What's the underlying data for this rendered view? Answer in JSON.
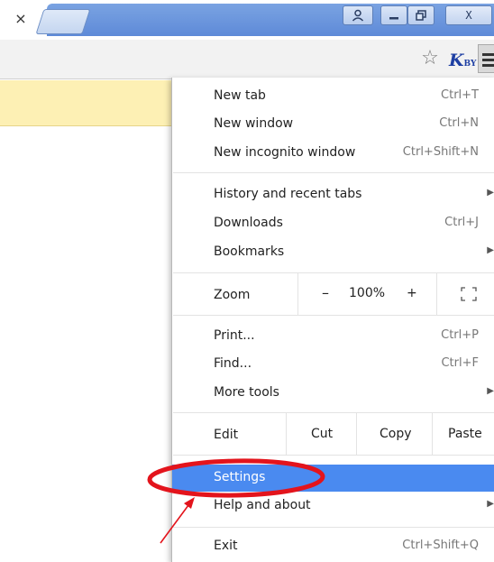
{
  "window": {
    "tab_close": "×",
    "user_button": "☃",
    "min_button": "_",
    "max_button": "□",
    "close_button": "X"
  },
  "toolbar": {
    "star_icon": "☆",
    "extension_text": "K",
    "extension_sub": "BY"
  },
  "menu": {
    "new_tab": {
      "label": "New tab",
      "shortcut": "Ctrl+T"
    },
    "new_window": {
      "label": "New window",
      "shortcut": "Ctrl+N"
    },
    "new_incognito": {
      "label": "New incognito window",
      "shortcut": "Ctrl+Shift+N"
    },
    "history": {
      "label": "History and recent tabs",
      "arrow": "▶"
    },
    "downloads": {
      "label": "Downloads",
      "shortcut": "Ctrl+J"
    },
    "bookmarks": {
      "label": "Bookmarks",
      "arrow": "▶"
    },
    "zoom": {
      "label": "Zoom",
      "minus": "–",
      "level": "100%",
      "plus": "+",
      "fullscreen": "⛶"
    },
    "print": {
      "label": "Print...",
      "shortcut": "Ctrl+P"
    },
    "find": {
      "label": "Find...",
      "shortcut": "Ctrl+F"
    },
    "more_tools": {
      "label": "More tools",
      "arrow": "▶"
    },
    "edit": {
      "label": "Edit",
      "cut": "Cut",
      "copy": "Copy",
      "paste": "Paste"
    },
    "settings": {
      "label": "Settings"
    },
    "help": {
      "label": "Help and about",
      "arrow": "▶"
    },
    "exit": {
      "label": "Exit",
      "shortcut": "Ctrl+Shift+Q"
    }
  },
  "colors": {
    "highlight": "#4a8af0",
    "annotation_red": "#e3141c"
  }
}
